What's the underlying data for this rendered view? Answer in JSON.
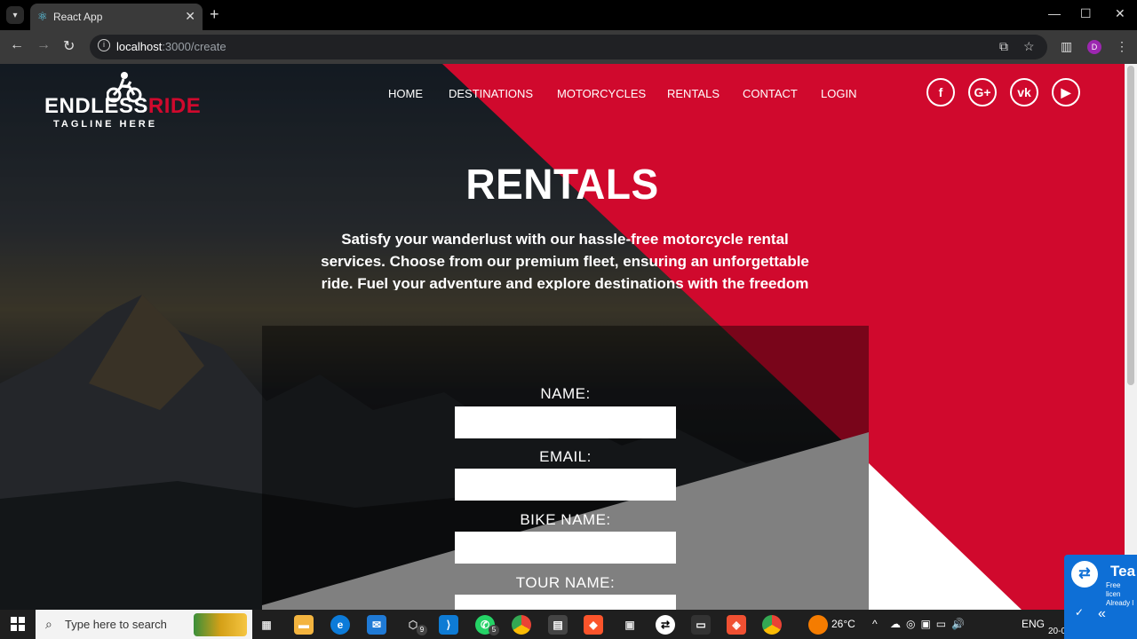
{
  "browser": {
    "tab_title": "React App",
    "tab_close": "✕",
    "new_tab": "+",
    "url_host": "localhost",
    "url_path": ":3000/create",
    "profile_initial": "D",
    "window_controls": [
      "—",
      "☐",
      "✕"
    ]
  },
  "site": {
    "brand_part1": "ENDLESS",
    "brand_part2": "RIDE",
    "tagline": "TAGLINE HERE",
    "accent_color": "#d0092d",
    "nav": [
      "HOME",
      "DESTINATIONS",
      "MOTORCYCLES",
      "RENTALS",
      "CONTACT",
      "LOGIN"
    ],
    "social": [
      {
        "icon": "facebook-icon",
        "glyph": "f"
      },
      {
        "icon": "google-plus-icon",
        "glyph": "G+"
      },
      {
        "icon": "vk-icon",
        "glyph": "vk"
      },
      {
        "icon": "youtube-icon",
        "glyph": "▶"
      }
    ]
  },
  "hero": {
    "title": "RENTALS",
    "text": "Satisfy your wanderlust with our hassle-free motorcycle rental services. Choose from our premium fleet, ensuring an unforgettable ride. Fuel your adventure and explore destinations with the freedom"
  },
  "form": {
    "fields": [
      {
        "label": "NAME:",
        "value": ""
      },
      {
        "label": "EMAIL:",
        "value": ""
      },
      {
        "label": "BIKE NAME:",
        "value": ""
      },
      {
        "label": "TOUR NAME:",
        "value": ""
      }
    ]
  },
  "taskbar": {
    "search_placeholder": "Type here to search",
    "weather": "26°C",
    "language": "ENG",
    "date_partial": "20-0",
    "badge_vscode": "9",
    "badge_whatsapp": "5"
  },
  "teamviewer": {
    "title": "Tea",
    "sub1": "Free licen",
    "sub2": "Already l"
  }
}
